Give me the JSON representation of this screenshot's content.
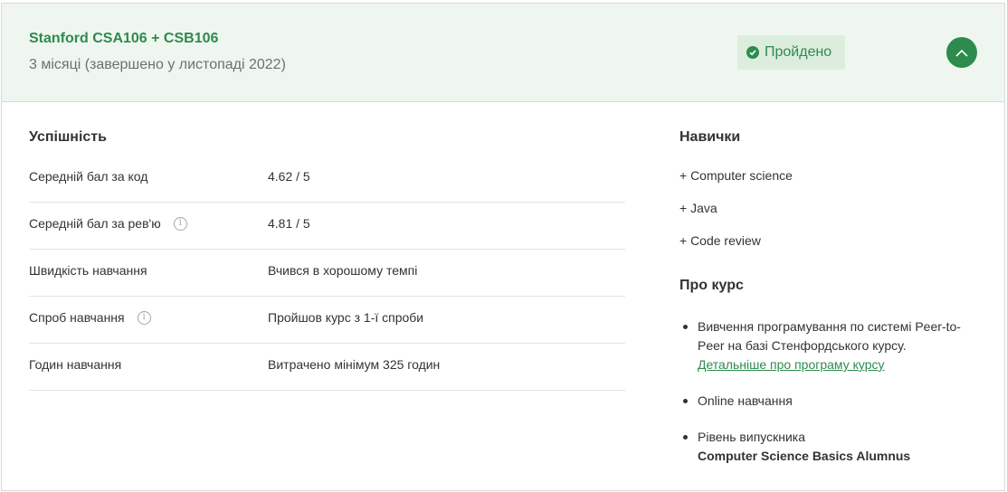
{
  "header": {
    "course_title": "Stanford CSA106 + CSB106",
    "duration": "3 місяці (завершено у листопаді 2022)",
    "status": "Пройдено",
    "status_icon": "check-circle-icon",
    "toggle_icon": "chevron-up-icon",
    "accent_color": "#2e8b4e"
  },
  "performance": {
    "title": "Успішність",
    "rows": [
      {
        "label": "Середній бал за код",
        "value": "4.62 / 5",
        "info": false
      },
      {
        "label": "Середній бал за рев'ю",
        "value": "4.81 / 5",
        "info": true
      },
      {
        "label": "Швидкість навчання",
        "value": "Вчився в хорошому темпі",
        "info": false
      },
      {
        "label": "Спроб навчання",
        "value": "Пройшов курс з 1-ї спроби",
        "info": true
      },
      {
        "label": "Годин навчання",
        "value": "Витрачено мінімум 325 годин",
        "info": false
      }
    ],
    "info_glyph": "i"
  },
  "skills": {
    "title": "Навички",
    "items": [
      "+ Computer science",
      "+ Java",
      "+ Code review"
    ]
  },
  "about": {
    "title": "Про курс",
    "description": "Вивчення програмування по системі Peer-to-Peer на базі Стенфордського курсу.",
    "link": "Детальніше про програму курсу",
    "mode": "Online навчання",
    "graduate_label": "Рівень випускника",
    "graduate_value": "Computer Science Basics Alumnus"
  }
}
